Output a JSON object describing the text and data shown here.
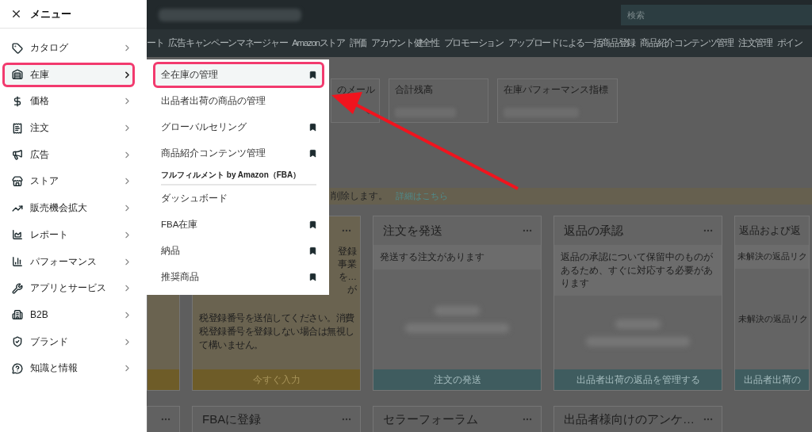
{
  "header": {
    "search": {
      "placeholder": "検索"
    }
  },
  "nav": [
    "ート",
    "広告キャンペーンマネージャー",
    "Amazonストア",
    "評価",
    "アカウント健全性",
    "プロモーション",
    "アップロードによる一括商品登録",
    "商品紹介コンテンツ管理",
    "注文管理",
    "ポイン"
  ],
  "metrics": [
    {
      "kind": "dropdown",
      "label": "のメール"
    },
    {
      "kind": "value",
      "label": "合計残高"
    },
    {
      "kind": "value",
      "label": "在庫パフォーマンス指標"
    }
  ],
  "notice": {
    "text": "削除します。",
    "link": "詳細はこちら"
  },
  "cards": [
    {
      "kind": "partial"
    },
    {
      "kind": "notice",
      "fragments": [
        "登録",
        "事業",
        "を…",
        "が"
      ],
      "lines": [
        "税登録番号を送信してください。消費",
        "税登録番号を登録しない場合は無視し",
        "て構いません。"
      ],
      "action": "今すぐ入力"
    },
    {
      "kind": "task",
      "title": "注文を発送",
      "band": "発送する注文があります",
      "action": "注文の発送"
    },
    {
      "kind": "task",
      "title": "返品の承認",
      "band": "返品の承認について保留中のものがあるため、すぐに対応する必要があります",
      "action": "出品者出荷の返品を管理する"
    },
    {
      "kind": "task",
      "title": "返品および返",
      "band": "未解決の返品リク",
      "body": "未解決の返品リク",
      "action": "出品者出荷の"
    }
  ],
  "bottom_cards": [
    {
      "kind": "partial"
    },
    {
      "kind": "card",
      "title": "FBAに登録"
    },
    {
      "kind": "card",
      "title": "セラーフォーラム"
    },
    {
      "kind": "card",
      "title": "出品者様向けのアンケ…"
    }
  ],
  "menu": {
    "title": "メニュー",
    "items": [
      {
        "label": "カタログ",
        "selected": false
      },
      {
        "label": "在庫",
        "selected": true
      },
      {
        "label": "価格",
        "selected": false
      },
      {
        "label": "注文",
        "selected": false
      },
      {
        "label": "広告",
        "selected": false
      },
      {
        "label": "ストア",
        "selected": false
      },
      {
        "label": "販売機会拡大",
        "selected": false
      },
      {
        "label": "レポート",
        "selected": false
      },
      {
        "label": "パフォーマンス",
        "selected": false
      },
      {
        "label": "アプリとサービス",
        "selected": false
      },
      {
        "label": "B2B",
        "selected": false
      },
      {
        "label": "ブランド",
        "selected": false
      },
      {
        "label": "知識と情報",
        "selected": false
      }
    ]
  },
  "submenu": {
    "items": [
      {
        "kind": "link",
        "label": "全在庫の管理",
        "selected": true,
        "bookmarked": true
      },
      {
        "kind": "link",
        "label": "出品者出荷の商品の管理",
        "selected": false,
        "bookmarked": false
      },
      {
        "kind": "link",
        "label": "グローバルセリング",
        "selected": false,
        "bookmarked": true
      },
      {
        "kind": "link",
        "label": "商品紹介コンテンツ管理",
        "selected": false,
        "bookmarked": true
      },
      {
        "kind": "header",
        "label": "フルフィルメント by Amazon（FBA）"
      },
      {
        "kind": "link",
        "label": "ダッシュボード",
        "selected": false,
        "bookmarked": false
      },
      {
        "kind": "link",
        "label": "FBA在庫",
        "selected": false,
        "bookmarked": true
      },
      {
        "kind": "link",
        "label": "納品",
        "selected": false,
        "bookmarked": true
      },
      {
        "kind": "link",
        "label": "推奨商品",
        "selected": false,
        "bookmarked": true
      }
    ]
  }
}
